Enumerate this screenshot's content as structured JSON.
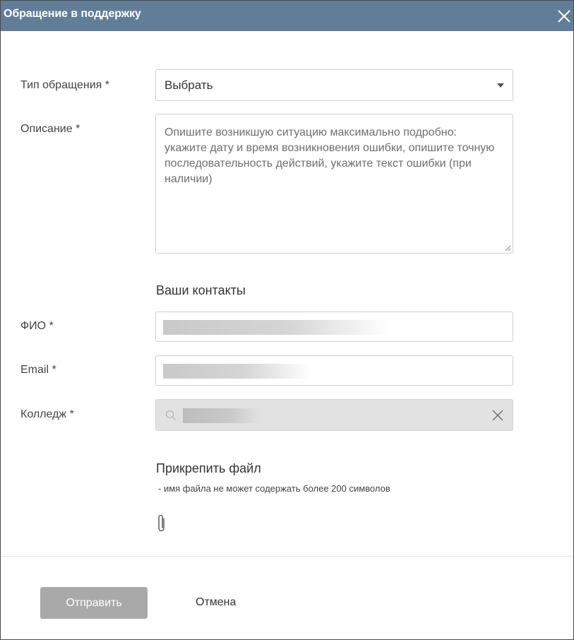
{
  "dialog": {
    "title": "Обращение в поддержку",
    "close_icon": "close-icon"
  },
  "form": {
    "type": {
      "label": "Тип обращения *",
      "value": "Выбрать"
    },
    "description": {
      "label": "Описание *",
      "placeholder": "Опишите возникшую ситуацию максимально подробно: укажите дату и время возникновения ошибки, опишите точную последовательность действий, укажите текст ошибки (при наличии)"
    },
    "contacts_title": "Ваши контакты",
    "fio": {
      "label": "ФИО *",
      "value": ""
    },
    "email": {
      "label": "Email *",
      "value": ""
    },
    "college": {
      "label": "Колледж *",
      "value": "",
      "search_icon": "search-icon",
      "clear_icon": "clear-icon"
    },
    "attach": {
      "title": "Прикрепить файл",
      "note": " - имя файла не может содержать более 200 символов",
      "icon": "paperclip-icon"
    }
  },
  "footer": {
    "submit_label": "Отправить",
    "cancel_label": "Отмена"
  },
  "colors": {
    "titlebar": "#617d98",
    "submit_disabled": "#a9a9a9"
  }
}
